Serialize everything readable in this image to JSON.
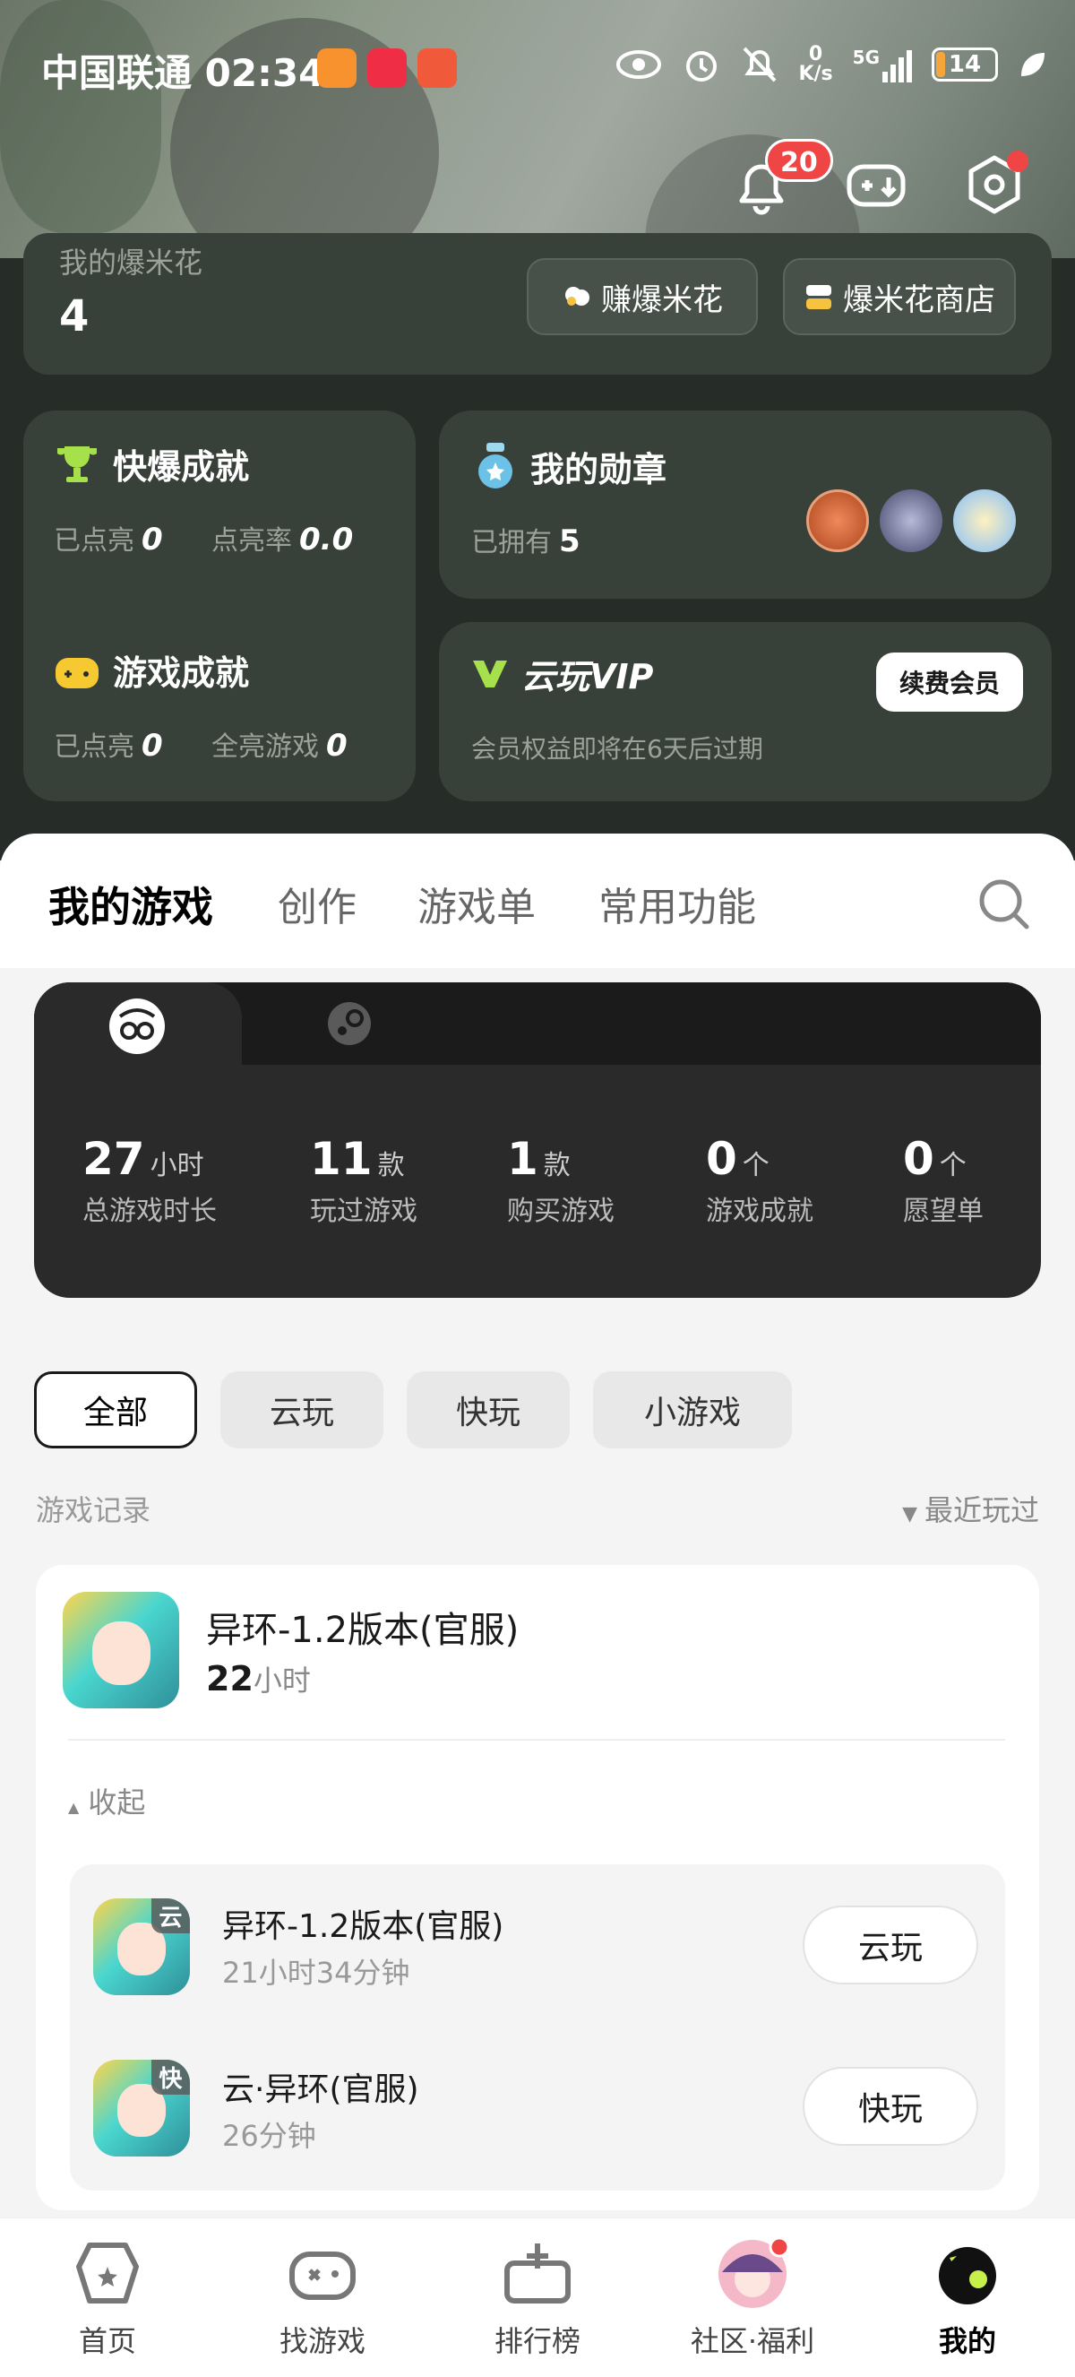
{
  "status_bar": {
    "carrier_time": "中国联通 02:34",
    "net_speed_value": "0",
    "net_speed_unit": "K/s",
    "network": "5G",
    "battery": "14"
  },
  "header": {
    "notification_count": "20"
  },
  "popcorn": {
    "label": "我的爆米花",
    "count": "4",
    "earn_label": "赚爆米花",
    "shop_label": "爆米花商店"
  },
  "quick_achievement": {
    "title": "快爆成就",
    "lit_label": "已点亮",
    "lit_value": "0",
    "rate_label": "点亮率",
    "rate_value": "0.0"
  },
  "medals": {
    "title": "我的勋章",
    "owned_label": "已拥有",
    "owned_value": "5"
  },
  "game_achievement": {
    "title": "游戏成就",
    "lit_label": "已点亮",
    "lit_value": "0",
    "full_label": "全亮游戏",
    "full_value": "0"
  },
  "vip": {
    "title": "云玩VIP",
    "note": "会员权益即将在6天后过期",
    "renew_label": "续费会员"
  },
  "tabs": [
    "我的游戏",
    "创作",
    "游戏单",
    "常用功能"
  ],
  "stats": [
    {
      "value": "27",
      "unit": "小时",
      "label": "总游戏时长"
    },
    {
      "value": "11",
      "unit": "款",
      "label": "玩过游戏"
    },
    {
      "value": "1",
      "unit": "款",
      "label": "购买游戏"
    },
    {
      "value": "0",
      "unit": "个",
      "label": "游戏成就"
    },
    {
      "value": "0",
      "unit": "个",
      "label": "愿望单"
    }
  ],
  "filters": [
    "全部",
    "云玩",
    "快玩",
    "小游戏"
  ],
  "records": {
    "title": "游戏记录",
    "sort_label": "最近玩过"
  },
  "main_game": {
    "name": "异环-1.2版本(官服)",
    "hours": "22",
    "hours_unit": "小时"
  },
  "collapse_label": "收起",
  "sub_games": [
    {
      "tag": "云",
      "name": "异环-1.2版本(官服)",
      "duration": "21小时34分钟",
      "action": "云玩"
    },
    {
      "tag": "快",
      "name": "云·异环(官服)",
      "duration": "26分钟",
      "action": "快玩"
    }
  ],
  "bottom_nav": [
    "首页",
    "找游戏",
    "排行榜",
    "社区·福利",
    "我的"
  ],
  "colors": {
    "accent_green": "#c8f04a",
    "badge_red": "#f04545",
    "dark_card": "#38403a"
  }
}
